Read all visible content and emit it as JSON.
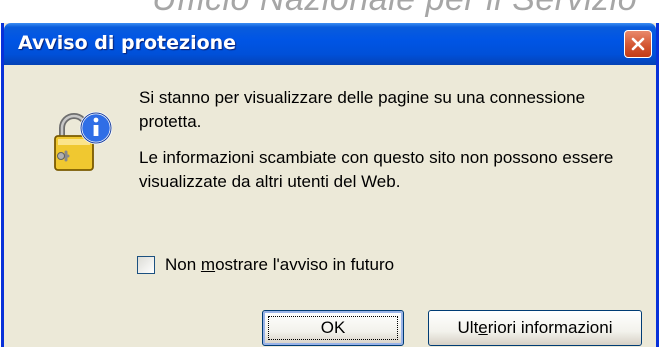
{
  "background": {
    "text": "Ufficio Nazionale per il Servizio"
  },
  "dialog": {
    "title": "Avviso di protezione",
    "message_1": "Si stanno per visualizzare delle pagine su una connessione protetta.",
    "message_2": "Le informazioni scambiate con questo sito non possono essere visualizzate da altri utenti del Web.",
    "checkbox": {
      "label_prefix": "Non ",
      "label_accel": "m",
      "label_suffix": "ostrare l'avviso in futuro",
      "checked": false
    },
    "buttons": {
      "ok": "OK",
      "more_prefix": "Ult",
      "more_accel": "e",
      "more_suffix": "riori informazioni"
    }
  },
  "icons": {
    "main": "padlock-info-icon",
    "close": "close-icon"
  },
  "colors": {
    "title_bar": "#0055e5",
    "dialog_bg": "#ece9d8",
    "close_button": "#d45633"
  }
}
